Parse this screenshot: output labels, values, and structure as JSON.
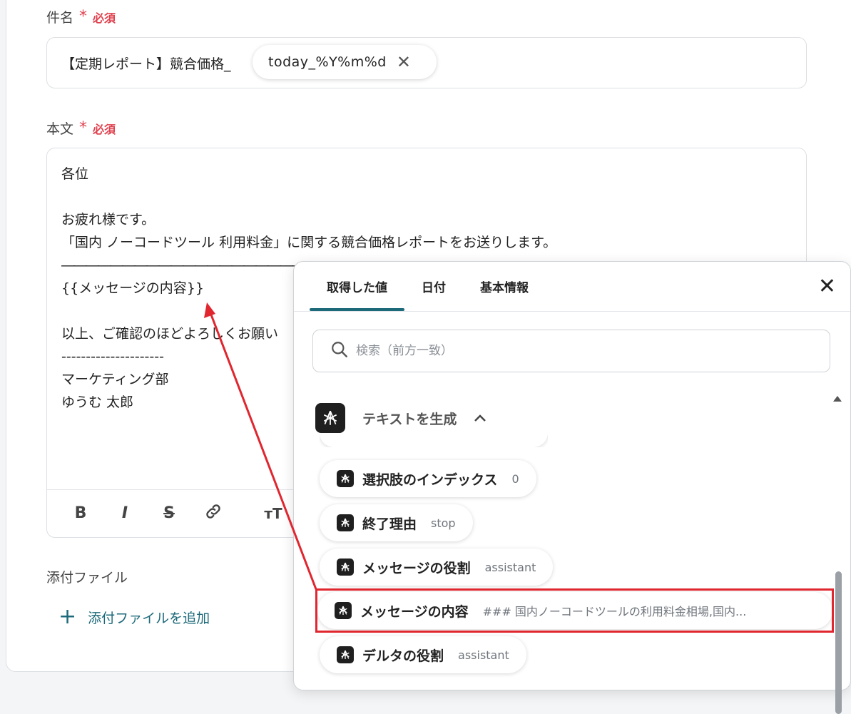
{
  "subject": {
    "label": "件名",
    "required_star": "*",
    "required_text": "必須",
    "prefix": "【定期レポート】競合価格_",
    "chip": "today_%Y%m%d"
  },
  "body": {
    "label": "本文",
    "required_star": "*",
    "required_text": "必須",
    "lines": [
      "各位",
      "",
      "お疲れ様です。",
      "「国内 ノーコードツール 利用料金」に関する競合価格レポートをお送りします。",
      "――――――――――――――――――――――――",
      "{{メッセージの内容}}",
      "",
      "以上、ご確認のほどよろしくお願い",
      "---------------------",
      "マーケティング部",
      "ゆうむ 太郎"
    ]
  },
  "toolbar": {
    "bold": "B",
    "italic": "I",
    "strike": "S",
    "link": "link-icon",
    "text_size": "text-size-icon"
  },
  "attachments": {
    "label": "添付ファイル",
    "add_label": "添付ファイルを追加"
  },
  "popup": {
    "tabs": [
      "取得した値",
      "日付",
      "基本情報"
    ],
    "active_tab": 0,
    "search_placeholder": "検索（前方一致）",
    "section_title": "テキストを生成",
    "items": [
      {
        "name": "選択肢のインデックス",
        "value": "0"
      },
      {
        "name": "終了理由",
        "value": "stop"
      },
      {
        "name": "メッセージの役割",
        "value": "assistant"
      },
      {
        "name": "メッセージの内容",
        "value": "### 国内ノーコードツールの利用料金相場,国内..."
      },
      {
        "name": "デルタの役割",
        "value": "assistant"
      }
    ]
  },
  "colors": {
    "accent": "#1d6a7a",
    "required": "#e0424f",
    "highlight": "#e0262f"
  }
}
